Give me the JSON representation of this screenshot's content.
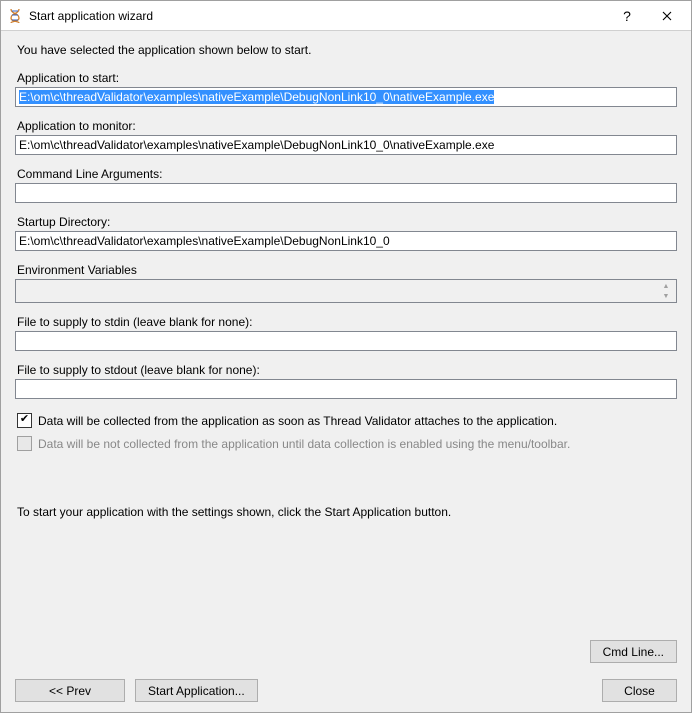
{
  "window": {
    "title": "Start application wizard"
  },
  "content": {
    "intro": "You have selected the application shown below to start.",
    "appToStartLabel": "Application to start:",
    "appToStartValue": "E:\\om\\c\\threadValidator\\examples\\nativeExample\\DebugNonLink10_0\\nativeExample.exe",
    "appToMonitorLabel": "Application to monitor:",
    "appToMonitorValue": "E:\\om\\c\\threadValidator\\examples\\nativeExample\\DebugNonLink10_0\\nativeExample.exe",
    "cmdArgsLabel": "Command Line Arguments:",
    "cmdArgsValue": "",
    "startupDirLabel": "Startup Directory:",
    "startupDirValue": "E:\\om\\c\\threadValidator\\examples\\nativeExample\\DebugNonLink10_0",
    "envVarsLabel": "Environment Variables",
    "envVarsValue": "",
    "stdinLabel": "File to supply to stdin (leave blank for none):",
    "stdinValue": "",
    "stdoutLabel": "File to supply to stdout (leave blank for none):",
    "stdoutValue": "",
    "checkCollectNow": "Data will be collected from the application as soon as Thread Validator attaches to the application.",
    "checkCollectLater": "Data will be not collected from the application until data collection is enabled using the menu/toolbar.",
    "startHint": "To start your application with the settings shown, click the Start Application button."
  },
  "buttons": {
    "cmdLine": "Cmd Line...",
    "prev": "<< Prev",
    "startApp": "Start Application...",
    "close": "Close"
  }
}
